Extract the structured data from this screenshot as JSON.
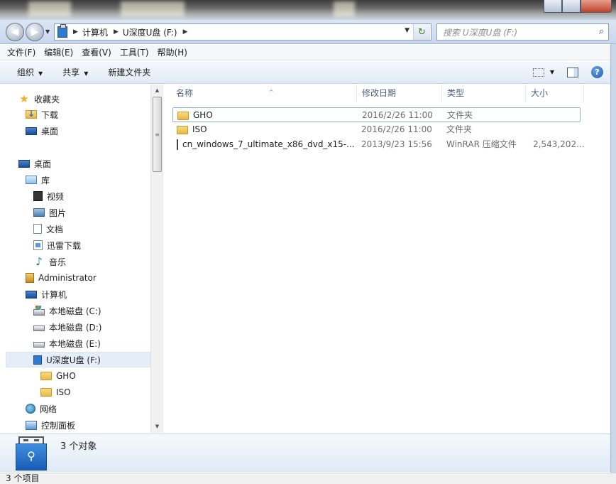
{
  "address": {
    "crumbs": [
      "计算机",
      "U深度U盘 (F:)"
    ],
    "search_placeholder": "搜索 U深度U盘 (F:)"
  },
  "menu": [
    "文件(F)",
    "编辑(E)",
    "查看(V)",
    "工具(T)",
    "帮助(H)"
  ],
  "toolbar": {
    "organize": "组织",
    "share": "共享",
    "new_folder": "新建文件夹"
  },
  "nav": {
    "favorites": "收藏夹",
    "downloads": "下载",
    "desktop_fav": "桌面",
    "desktop": "桌面",
    "libraries": "库",
    "videos": "视频",
    "pictures": "图片",
    "documents": "文档",
    "xunlei": "迅雷下载",
    "music": "音乐",
    "admin": "Administrator",
    "computer": "计算机",
    "drive_c": "本地磁盘 (C:)",
    "drive_d": "本地磁盘 (D:)",
    "drive_e": "本地磁盘 (E:)",
    "drive_f": "U深度U盘 (F:)",
    "sub_gho": "GHO",
    "sub_iso": "ISO",
    "network": "网络",
    "control_panel": "控制面板"
  },
  "columns": {
    "name": "名称",
    "modified": "修改日期",
    "type": "类型",
    "size": "大小"
  },
  "files": [
    {
      "name": "GHO",
      "modified": "2016/2/26 11:00",
      "type": "文件夹",
      "size": ""
    },
    {
      "name": "ISO",
      "modified": "2016/2/26 11:00",
      "type": "文件夹",
      "size": ""
    },
    {
      "name": "cn_windows_7_ultimate_x86_dvd_x15-...",
      "modified": "2013/9/23 15:56",
      "type": "WinRAR 压缩文件",
      "size": "2,543,202..."
    }
  ],
  "details": {
    "summary": "3 个对象"
  },
  "status": {
    "count": "3 个项目"
  }
}
